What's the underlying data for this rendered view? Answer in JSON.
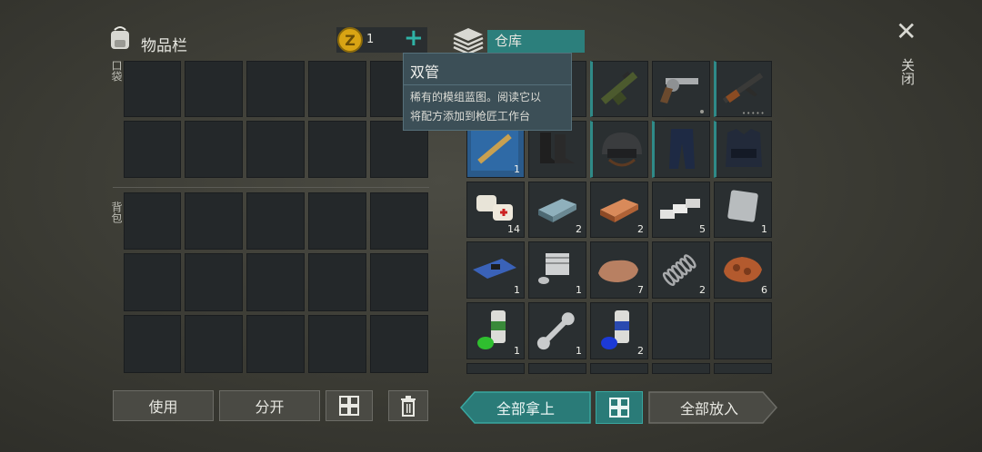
{
  "inventory": {
    "title": "物品栏",
    "pocket_label": "口袋",
    "backpack_label": "背包"
  },
  "currency": {
    "amount": "1",
    "add_symbol": "+"
  },
  "storage": {
    "title": "仓库"
  },
  "close": {
    "label": "关闭",
    "symbol": "✕"
  },
  "tooltip": {
    "name": "双管",
    "description_line1": "稀有的模组蓝图。阅读它以",
    "description_line2": "将配方添加到枪匠工作台"
  },
  "buttons": {
    "use": "使用",
    "split": "分开",
    "take_all": "全部拿上",
    "put_all": "全部放入"
  },
  "storage_items": [
    {
      "name": "rifle-grenade-launcher",
      "count": ""
    },
    {
      "name": "revolver",
      "count": ""
    },
    {
      "name": "assault-rifle",
      "count": ""
    },
    {
      "name": "rifle-blueprint",
      "count": "1"
    },
    {
      "name": "combat-boots",
      "count": ""
    },
    {
      "name": "combat-helmet",
      "count": ""
    },
    {
      "name": "tactical-pants",
      "count": ""
    },
    {
      "name": "tactical-vest",
      "count": ""
    },
    {
      "name": "bandage-medkit",
      "count": "14"
    },
    {
      "name": "steel-ingot",
      "count": "2"
    },
    {
      "name": "copper-ingot",
      "count": "2"
    },
    {
      "name": "aluminum-bars",
      "count": "5"
    },
    {
      "name": "metal-plate",
      "count": "1"
    },
    {
      "name": "circuit-board",
      "count": "1"
    },
    {
      "name": "engine-cylinder",
      "count": "1"
    },
    {
      "name": "stone-ore",
      "count": "7"
    },
    {
      "name": "metal-spring",
      "count": "2"
    },
    {
      "name": "copper-ore",
      "count": "6"
    },
    {
      "name": "green-paint-can",
      "count": "1"
    },
    {
      "name": "wrench",
      "count": "1"
    },
    {
      "name": "blue-paint-can",
      "count": "2"
    }
  ]
}
